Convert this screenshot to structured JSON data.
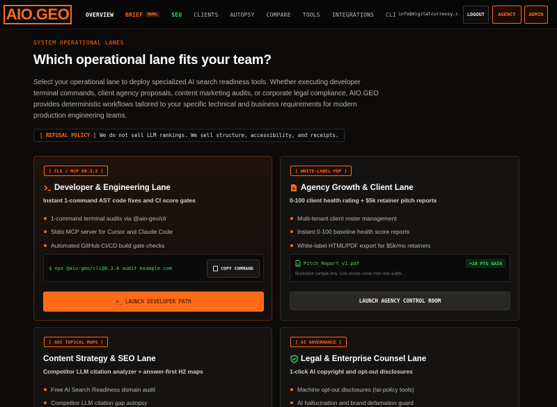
{
  "nav": {
    "logo": "AIO.GEO",
    "links": [
      "OVERVIEW",
      "BRIEF",
      "SEO",
      "CLIENTS",
      "AUTOPSY",
      "COMPARE",
      "TOOLS",
      "INTEGRATIONS",
      "CLI"
    ],
    "brief_badge": "DUAL",
    "email": "info@digitalcurrensy.c...",
    "logout": "LOGOUT",
    "agency": "AGENCY",
    "admin": "ADMIN"
  },
  "hero": {
    "eyebrow": "SYSTEM OPERATIONAL LANES",
    "title": "Which operational lane fits your team?",
    "lead": "Select your operational lane to deploy specialized AI search readiness tools. Whether executing developer terminal commands, client agency proposals, content marketing audits, or corporate legal compliance, AIO.GEO provides deterministic workflows tailored to your specific technical and business requirements for modern production engineering teams.",
    "policy_tag": "[ REFUSAL POLICY ]",
    "policy_text": "We do not sell LLM rankings. We sell structure, accessibility, and receipts."
  },
  "cards": {
    "dev": {
      "badge": "[ CLI / MCP V0.3.2 ]",
      "title": "Developer & Engineering Lane",
      "subtitle": "Instant 1-command AST code fixes and CI score gates",
      "features": [
        "1-command terminal audits via @aio-geo/cli",
        "Stdio MCP server for Cursor and Claude Code",
        "Automated GitHub CI/CD build gate checks"
      ],
      "command": "$ npx @aio-geo/cli@0.3.4 audit example.com",
      "copy": "COPY COMMAND",
      "launch": ">_ LAUNCH DEVELOPER PATH"
    },
    "agency": {
      "badge": "[ WHITE-LABEL PDF ]",
      "title": "Agency Growth & Client Lane",
      "subtitle": "0-100 client health rating + $5k retainer pitch reports",
      "features": [
        "Multi-tenant client roster management",
        "Instant 0-100 baseline health score reports",
        "White-label HTML/PDF export for $5k/mo retainers"
      ],
      "file": "Pitch_Report_v1.pdf",
      "gain": "+28 PTS GAIN",
      "note": "Illustrative sample only. Live scores come from real audits.",
      "launch": "LAUNCH AGENCY CONTROL ROOM"
    },
    "content": {
      "badge": "[ GSC TOPICAL MAPS ]",
      "title": "Content Strategy & SEO Lane",
      "subtitle": "Competitor LLM citation analyzer + answer-first H2 maps",
      "features": [
        "Free AI Search Readiness domain audit",
        "Competitor LLM citation gap autopsy"
      ]
    },
    "legal": {
      "badge": "[ AI GOVERNANCE ]",
      "title": "Legal & Enterprise Counsel Lane",
      "subtitle": "1-click AI copyright and opt-out disclosures",
      "features": [
        "Machine opt-out disclosures (/ai-policy tools)",
        "AI hallucination and brand defamation guard"
      ]
    }
  },
  "colors": {
    "accent": "#ff6a1a",
    "green": "#3ddc62",
    "bg": "#0c0b0a"
  }
}
